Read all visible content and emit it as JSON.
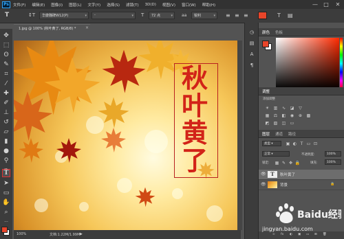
{
  "app": {
    "logo": "Ps"
  },
  "menu": [
    "文件(F)",
    "编辑(E)",
    "图像(I)",
    "图层(L)",
    "文字(Y)",
    "选择(S)",
    "滤镜(T)",
    "3D(D)",
    "视图(V)",
    "窗口(W)",
    "帮助(H)"
  ],
  "window_controls": {
    "minimize": "—",
    "maximize": "□",
    "close": "✕"
  },
  "options": {
    "tool_icon": "T",
    "orientation_icon": "↕T",
    "font_family": "华康魏碑W12(P)",
    "font_style": "-",
    "size_icon": "T",
    "font_size": "72 点",
    "aa_label": "aa",
    "antialias": "锐利",
    "align": [
      "≡",
      "≡",
      "≡"
    ],
    "color_swatch": "#e8452a",
    "warp_icon": "T",
    "panels_icon": "▤"
  },
  "document": {
    "tab_label": "1.jpg @ 100% (秋叶黄了, RGB/8) *",
    "close": "×"
  },
  "canvas": {
    "title_chars": [
      "秋",
      "叶",
      "黄",
      "了"
    ],
    "title_color": "#d22318"
  },
  "status": {
    "zoom": "100%",
    "doc_size": "文档:1.22M/1.99M",
    "arrow": "▶"
  },
  "panels": {
    "color_tabs": [
      "颜色",
      "色板"
    ],
    "fg_color": "#e8452a",
    "bg_color": "#ffffff",
    "adjust_tab": "调整",
    "adjust_label": "添加调整",
    "layers_tabs": [
      "图层",
      "通道",
      "路径"
    ],
    "kind_label": "类型",
    "blend_mode": "正常",
    "opacity_label": "不透明度:",
    "opacity_value": "100%",
    "lock_label": "锁定:",
    "fill_label": "填充:",
    "fill_value": "100%",
    "layers": [
      {
        "name": "秋叶黄了",
        "thumb": "T",
        "type": "text"
      },
      {
        "name": "背景",
        "thumb": "",
        "type": "image",
        "lock": "🔒"
      }
    ],
    "layer_footer": [
      "∞",
      "fx",
      "◐",
      "▣",
      "▭",
      "⊞",
      "🗑"
    ]
  },
  "watermark": {
    "brand": "Baidu经验",
    "url": "jingyan.baidu.com"
  }
}
